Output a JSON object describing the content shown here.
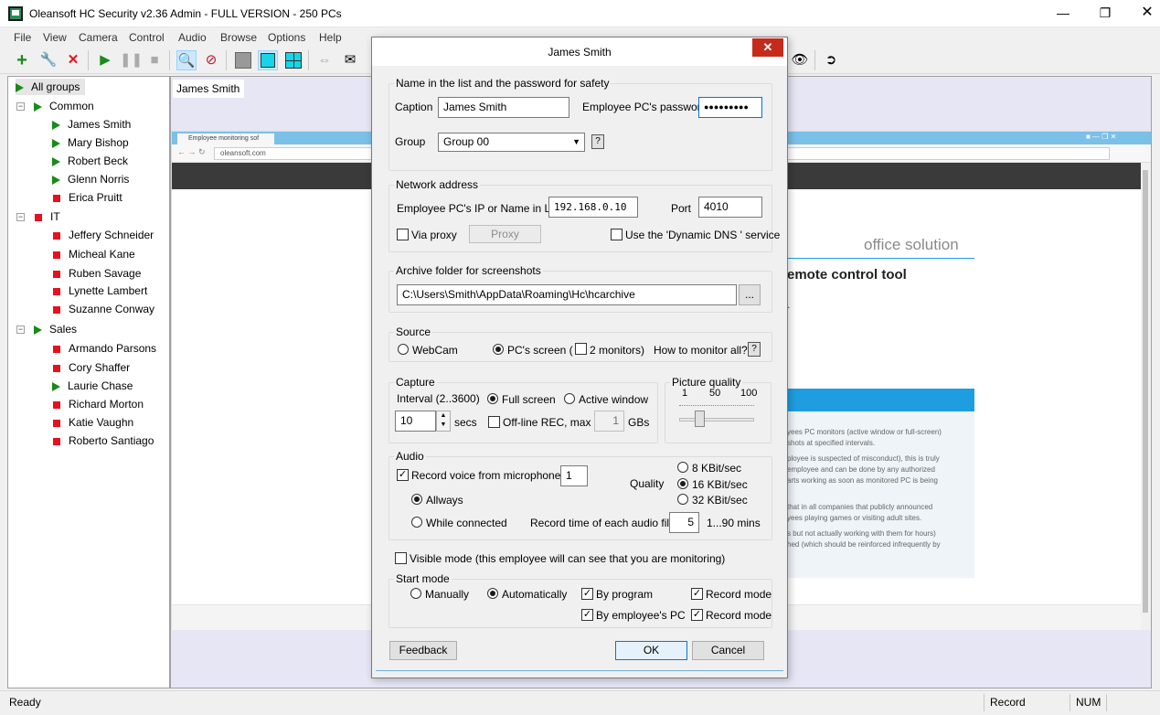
{
  "window": {
    "title": "Oleansoft HC Security v2.36 Admin - FULL VERSION - 250 PCs"
  },
  "menu": [
    "File",
    "View",
    "Camera",
    "Control",
    "Audio",
    "Browse",
    "Options",
    "Help"
  ],
  "tree": {
    "root": "All groups",
    "groups": [
      {
        "name": "Common",
        "members": [
          "James Smith",
          "Mary Bishop",
          "Robert Beck",
          "Glenn Norris",
          "Erica Pruitt"
        ]
      },
      {
        "name": "IT",
        "members": [
          "Jeffery Schneider",
          "Micheal Kane",
          "Ruben Savage",
          "Lynette Lambert",
          "Suzanne Conway"
        ]
      },
      {
        "name": "Sales",
        "members": [
          "Armando Parsons",
          "Cory Shaffer",
          "Laurie Chase",
          "Richard Morton",
          "Katie Vaughn",
          "Roberto Santiago"
        ]
      }
    ]
  },
  "thumbnail": {
    "label": "James Smith",
    "browser_tab": "Employee monitoring sof",
    "url": "oleansoft.com",
    "heading1": "office solution",
    "heading2": "emote control tool",
    "dot": ".",
    "panel_lines": [
      "yees PC monitors (active window or full-screen)",
      "shots at specified intervals.",
      "ployee is suspected of misconduct), this is truly",
      "employee and can be done by any authorized",
      "arts working as soon as monitored PC is being",
      "that in all companies that publicly announced",
      "yees playing games or visiting adult sites.",
      "s but not actually working with them for hours)",
      "hed (which should be reinforced infrequently by"
    ]
  },
  "status": {
    "ready": "Ready",
    "record": "Record",
    "num": "NUM"
  },
  "dialog": {
    "title": "James Smith",
    "close": "✕",
    "name_group": {
      "legend": "Name in the list and the password for safety",
      "caption_label": "Caption",
      "caption_value": "James Smith",
      "password_label": "Employee PC's password",
      "password_value": "●●●●●●●●●",
      "group_label": "Group",
      "group_value": "Group 00",
      "help": "?"
    },
    "network": {
      "legend": "Network address",
      "ip_label": "Employee PC's IP or Name in LAN",
      "ip_value": "192.168.0.10",
      "port_label": "Port",
      "port_value": "4010",
      "via_proxy": "Via proxy",
      "proxy_button": "Proxy",
      "ddns": "Use the 'Dynamic DNS ' service"
    },
    "archive": {
      "legend": "Archive folder for screenshots",
      "path": "C:\\Users\\Smith\\AppData\\Roaming\\Hc\\hcarchive",
      "browse": "..."
    },
    "source": {
      "legend": "Source",
      "webcam": "WebCam",
      "pcscreen": "PC's screen (",
      "two_monitors": "2 monitors)",
      "how": "How to monitor all?",
      "help": "?"
    },
    "capture": {
      "legend": "Capture",
      "interval_label": "Interval (2..3600)",
      "interval_value": "10",
      "secs": "secs",
      "full_screen": "Full screen",
      "active_window": "Active window",
      "offline": "Off-line REC, max",
      "offline_value": "1",
      "gbs": "GBs"
    },
    "quality": {
      "legend": "Picture quality",
      "t1": "1",
      "t50": "50",
      "t100": "100",
      "value": 25
    },
    "audio": {
      "legend": "Audio",
      "record_voice": "Record voice from microphone #",
      "mic_value": "1",
      "always": "Allways",
      "while_connected": "While connected",
      "quality_label": "Quality",
      "q8": "8 KBit/sec",
      "q16": "16 KBit/sec",
      "q32": "32 KBit/sec",
      "record_time": "Record time of each audio file",
      "record_time_value": "5",
      "mins": "1...90 mins"
    },
    "visible_mode": "Visible mode (this employee will can see that you are monitoring)",
    "start": {
      "legend": "Start mode",
      "manually": "Manually",
      "automatically": "Automatically",
      "by_program": "By program",
      "by_pc": "By employee's PC",
      "record_mode_1": "Record mode",
      "record_mode_2": "Record mode"
    },
    "buttons": {
      "feedback": "Feedback",
      "ok": "OK",
      "cancel": "Cancel"
    }
  },
  "colors": {
    "accent": "#0078d7",
    "close_red": "#c42b1c",
    "green": "#1a8a1a",
    "red": "#e8101e",
    "browser_blue": "#1e9ee0"
  }
}
